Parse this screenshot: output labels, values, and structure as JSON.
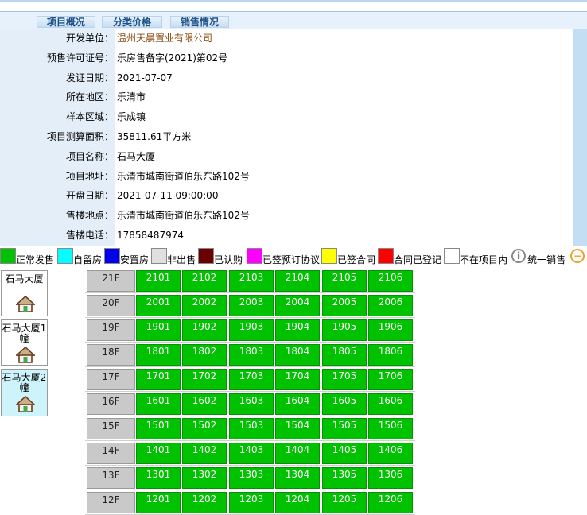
{
  "tabs": [
    {
      "label": "项目概况"
    },
    {
      "label": "分类价格"
    },
    {
      "label": "销售情况"
    }
  ],
  "info": [
    {
      "label": "开发单位：",
      "value": "温州天晨置业有限公司"
    },
    {
      "label": "预售许可证号：",
      "value": "乐房售备字(2021)第02号"
    },
    {
      "label": "发证日期：",
      "value": "2021-07-07"
    },
    {
      "label": "所在地区：",
      "value": "乐清市"
    },
    {
      "label": "样本区域：",
      "value": "乐成镇"
    },
    {
      "label": "项目测算面积：",
      "value": "35811.61平方米"
    },
    {
      "label": "项目名称：",
      "value": "石马大厦"
    },
    {
      "label": "项目地址：",
      "value": "乐清市城南街道伯乐东路102号"
    },
    {
      "label": "开盘日期：",
      "value": "2021-07-11 09:00:00"
    },
    {
      "label": "售楼地点：",
      "value": "乐清市城南街道伯乐东路102号"
    },
    {
      "label": "售楼电话：",
      "value": "17858487974"
    }
  ],
  "legend": [
    {
      "label": "正常发售",
      "color": "#00c200"
    },
    {
      "label": "自留房",
      "color": "#00ffff"
    },
    {
      "label": "安置房",
      "color": "#0000ee"
    },
    {
      "label": "非出售",
      "color": "#e0e0e0"
    },
    {
      "label": "已认购",
      "color": "#6b0000"
    },
    {
      "label": "已签预订协议",
      "color": "#ff00ff"
    },
    {
      "label": "已签合同",
      "color": "#ffff00"
    },
    {
      "label": "合同已登记",
      "color": "#ff0000"
    },
    {
      "label": "不在项目内",
      "color": "#ffffff"
    },
    {
      "label": "统一销售",
      "icon": "info-icon",
      "glyph": "i"
    },
    {
      "label": "",
      "icon": "minus-circle-icon",
      "glyph": "−"
    }
  ],
  "buildings": [
    {
      "label": "石马大厦",
      "selected": false
    },
    {
      "label": "石马大厦1幢",
      "selected": false
    },
    {
      "label": "石马大厦2幢",
      "selected": true
    }
  ],
  "floors": [
    {
      "label": "21F",
      "units": [
        "2101",
        "2102",
        "2103",
        "2104",
        "2105",
        "2106"
      ]
    },
    {
      "label": "20F",
      "units": [
        "2001",
        "2002",
        "2003",
        "2004",
        "2005",
        "2006"
      ]
    },
    {
      "label": "19F",
      "units": [
        "1901",
        "1902",
        "1903",
        "1904",
        "1905",
        "1906"
      ]
    },
    {
      "label": "18F",
      "units": [
        "1801",
        "1802",
        "1803",
        "1804",
        "1805",
        "1806"
      ]
    },
    {
      "label": "17F",
      "units": [
        "1701",
        "1702",
        "1703",
        "1704",
        "1705",
        "1706"
      ]
    },
    {
      "label": "16F",
      "units": [
        "1601",
        "1602",
        "1603",
        "1604",
        "1605",
        "1606"
      ]
    },
    {
      "label": "15F",
      "units": [
        "1501",
        "1502",
        "1503",
        "1504",
        "1505",
        "1506"
      ]
    },
    {
      "label": "14F",
      "units": [
        "1401",
        "1402",
        "1403",
        "1404",
        "1405",
        "1406"
      ]
    },
    {
      "label": "13F",
      "units": [
        "1301",
        "1302",
        "1303",
        "1304",
        "1305",
        "1306"
      ]
    },
    {
      "label": "12F",
      "units": [
        "1201",
        "1202",
        "1203",
        "1204",
        "1205",
        "1206"
      ]
    }
  ]
}
